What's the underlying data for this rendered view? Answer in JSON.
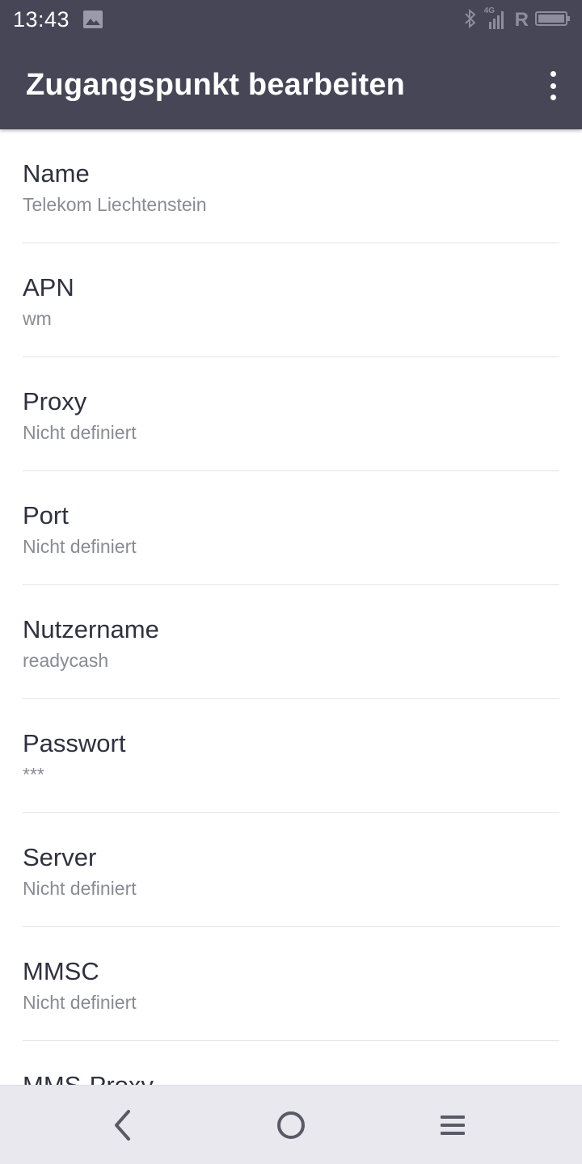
{
  "status_bar": {
    "time": "13:43",
    "network_label": "4G",
    "roaming_label": "R",
    "icons": [
      "gallery-icon",
      "bluetooth-icon",
      "signal-icon",
      "battery-icon"
    ]
  },
  "app_bar": {
    "title": "Zugangspunkt bearbeiten",
    "menu_icon": "more-vert-icon"
  },
  "settings": [
    {
      "title": "Name",
      "value": "Telekom Liechtenstein"
    },
    {
      "title": "APN",
      "value": "wm"
    },
    {
      "title": "Proxy",
      "value": "Nicht definiert"
    },
    {
      "title": "Port",
      "value": "Nicht definiert"
    },
    {
      "title": "Nutzername",
      "value": "readycash"
    },
    {
      "title": "Passwort",
      "value": "***"
    },
    {
      "title": "Server",
      "value": "Nicht definiert"
    },
    {
      "title": "MMSC",
      "value": "Nicht definiert"
    },
    {
      "title": "MMS-Proxy",
      "value": ""
    }
  ],
  "nav_bar": {
    "icons": [
      "back-icon",
      "home-icon",
      "menu-icon"
    ]
  },
  "colors": {
    "bar": "#464657",
    "title_text": "#2e3140",
    "value_text": "#8a8b95",
    "divider": "#e3e3e8",
    "nav_bg": "#e9e8ef"
  }
}
